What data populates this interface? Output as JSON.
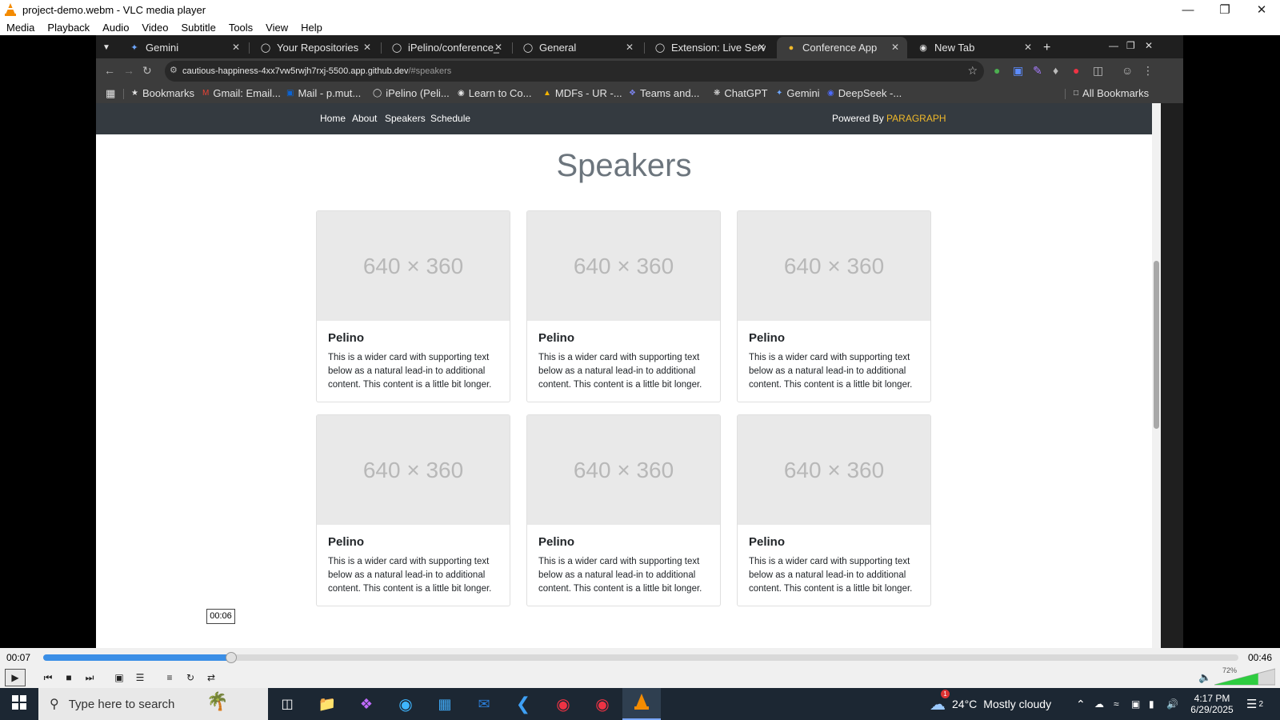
{
  "vlc": {
    "title": "project-demo.webm - VLC media player",
    "menu": [
      "Media",
      "Playback",
      "Audio",
      "Video",
      "Subtitle",
      "Tools",
      "View",
      "Help"
    ],
    "time_current": "00:07",
    "time_total": "00:46",
    "time_tooltip": "00:06",
    "seek_position": 0.157,
    "volume_label": "72%",
    "volume": 0.72
  },
  "browser": {
    "tabs": [
      {
        "label": "Gemini",
        "icon": "gemini-icon"
      },
      {
        "label": "Your Repositories",
        "icon": "github-icon"
      },
      {
        "label": "iPelino/conference_",
        "icon": "github-icon"
      },
      {
        "label": "General",
        "icon": "github-icon"
      },
      {
        "label": "Extension: Live Serv",
        "icon": "github-icon"
      },
      {
        "label": "Conference App",
        "icon": "codespaces-icon"
      },
      {
        "label": "New Tab",
        "icon": "chrome-icon"
      }
    ],
    "url_host": "cautious-happiness-4xx7vw5rwjh7rxj-5500.app.github.dev",
    "url_path": "/#speakers",
    "bookmarks": [
      {
        "label": "Bookmarks",
        "icon": "star-icon"
      },
      {
        "label": "Gmail: Email...",
        "icon": "gmail-icon"
      },
      {
        "label": "Mail - p.mut...",
        "icon": "outlook-icon"
      },
      {
        "label": "iPelino (Peli...",
        "icon": "github-icon"
      },
      {
        "label": "Learn to Co...",
        "icon": "alx-icon"
      },
      {
        "label": "MDFs - UR -...",
        "icon": "drive-icon"
      },
      {
        "label": "Teams and...",
        "icon": "teams-icon"
      },
      {
        "label": "ChatGPT",
        "icon": "chatgpt-icon"
      },
      {
        "label": "Gemini",
        "icon": "gemini-icon"
      },
      {
        "label": "DeepSeek -...",
        "icon": "deepseek-icon"
      }
    ],
    "all_bookmarks": "All Bookmarks"
  },
  "site": {
    "nav": [
      "Home",
      "About",
      "Speakers",
      "Schedule"
    ],
    "powered_prefix": "Powered By",
    "powered_brand": "PARAGRAPH",
    "heading": "Speakers",
    "cards": [
      {
        "placeholder": "640 × 360",
        "title": "Pelino",
        "text": "This is a wider card with supporting text below as a natural lead-in to additional content. This content is a little bit longer."
      },
      {
        "placeholder": "640 × 360",
        "title": "Pelino",
        "text": "This is a wider card with supporting text below as a natural lead-in to additional content. This content is a little bit longer."
      },
      {
        "placeholder": "640 × 360",
        "title": "Pelino",
        "text": "This is a wider card with supporting text below as a natural lead-in to additional content. This content is a little bit longer."
      },
      {
        "placeholder": "640 × 360",
        "title": "Pelino",
        "text": "This is a wider card with supporting text below as a natural lead-in to additional content. This content is a little bit longer."
      },
      {
        "placeholder": "640 × 360",
        "title": "Pelino",
        "text": "This is a wider card with supporting text below as a natural lead-in to additional content. This content is a little bit longer."
      },
      {
        "placeholder": "640 × 360",
        "title": "Pelino",
        "text": "This is a wider card with supporting text below as a natural lead-in to additional content. This content is a little bit longer."
      }
    ]
  },
  "taskbar": {
    "search_placeholder": "Type here to search",
    "weather_temp": "24°C",
    "weather_desc": "Mostly cloudy",
    "weather_badge": "1",
    "time": "4:17 PM",
    "date": "6/29/2025",
    "notification_count": "2"
  },
  "colors": {
    "navbar": "#343a40",
    "brand": "#f0b92a",
    "seek_fill": "#3a8ee6",
    "taskbar": "#1c2733"
  }
}
